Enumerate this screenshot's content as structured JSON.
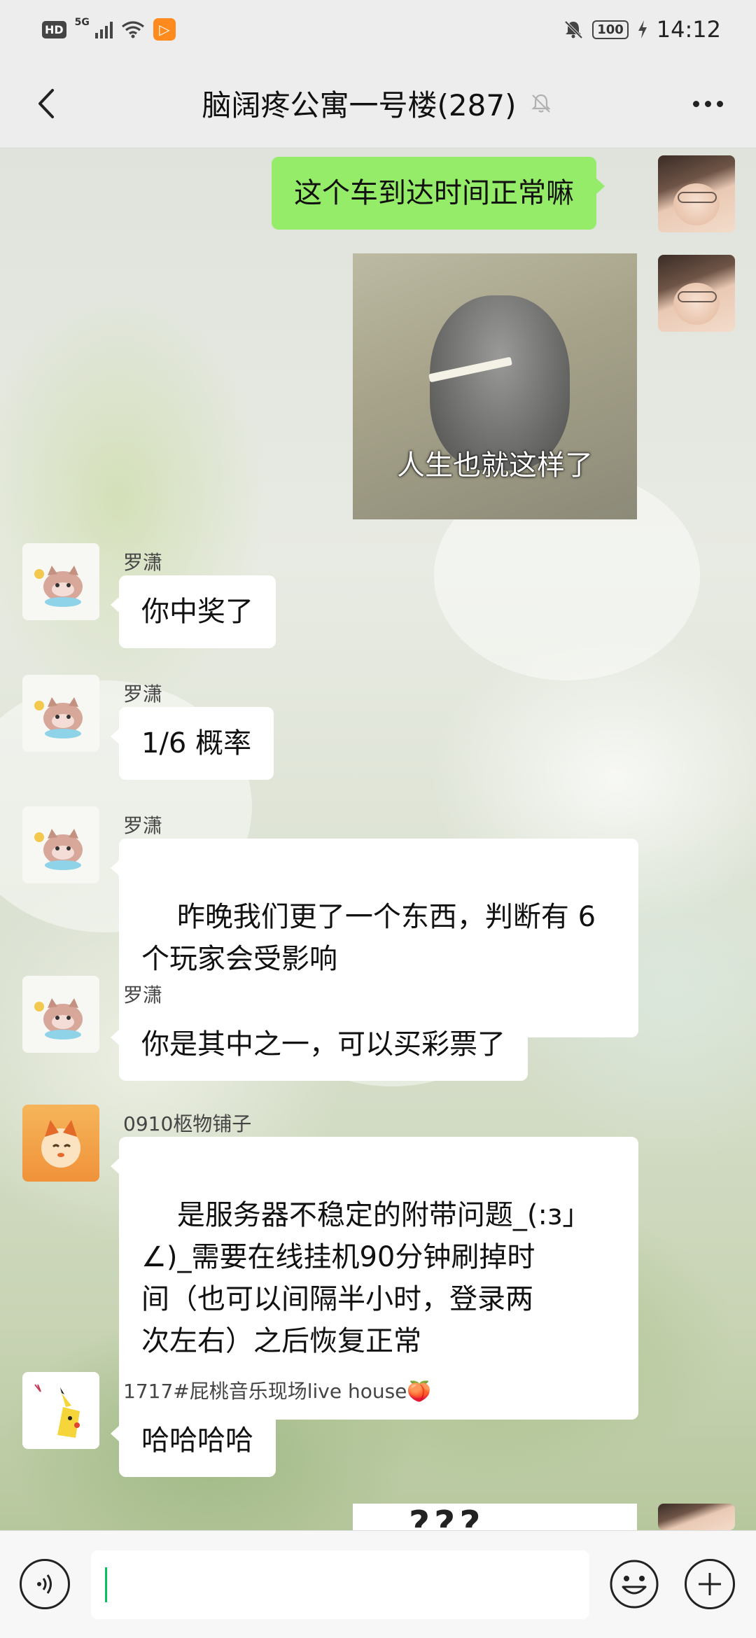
{
  "status_bar": {
    "hd": "HD",
    "network": "5G",
    "battery": "100",
    "time": "14:12",
    "icons": [
      "hd-icon",
      "signal-icon",
      "wifi-icon",
      "app-notification-icon",
      "mute-bell-icon",
      "battery-icon",
      "charging-icon"
    ]
  },
  "header": {
    "title": "脑阔疼公寓一号楼(287)",
    "icons": [
      "back-icon",
      "mute-bell-icon",
      "more-icon"
    ]
  },
  "messages": [
    {
      "from": "self",
      "type": "text",
      "text": "这个车到达时间正常嘛"
    },
    {
      "from": "self",
      "type": "sticker",
      "caption": "人生也就这样了"
    },
    {
      "from": "罗潇",
      "type": "text",
      "text": "你中奖了"
    },
    {
      "from": "罗潇",
      "type": "text",
      "text": "1/6 概率"
    },
    {
      "from": "罗潇",
      "type": "text",
      "text": "昨晚我们更了一个东西，判断有 6\n个玩家会受影响"
    },
    {
      "from": "罗潇",
      "type": "text",
      "text": "你是其中之一，可以买彩票了"
    },
    {
      "from": "0910柩物铺子",
      "type": "text",
      "text": "是服务器不稳定的附带问题_(:з」\n∠)_需要在线挂机90分钟刷掉时\n间（也可以间隔半小时，登录两\n次左右）之后恢复正常"
    },
    {
      "from": "1717#屁桃音乐现场live house🍑",
      "type": "text",
      "text": "哈哈哈哈"
    },
    {
      "from": "self",
      "type": "sticker",
      "caption": "???"
    }
  ],
  "input_bar": {
    "value": "",
    "icons": [
      "voice-icon",
      "emoji-icon",
      "plus-icon"
    ]
  },
  "colors": {
    "self_bubble": "#95ec69",
    "other_bubble": "#ffffff",
    "caret": "#07c160",
    "chrome": "#ededed"
  }
}
